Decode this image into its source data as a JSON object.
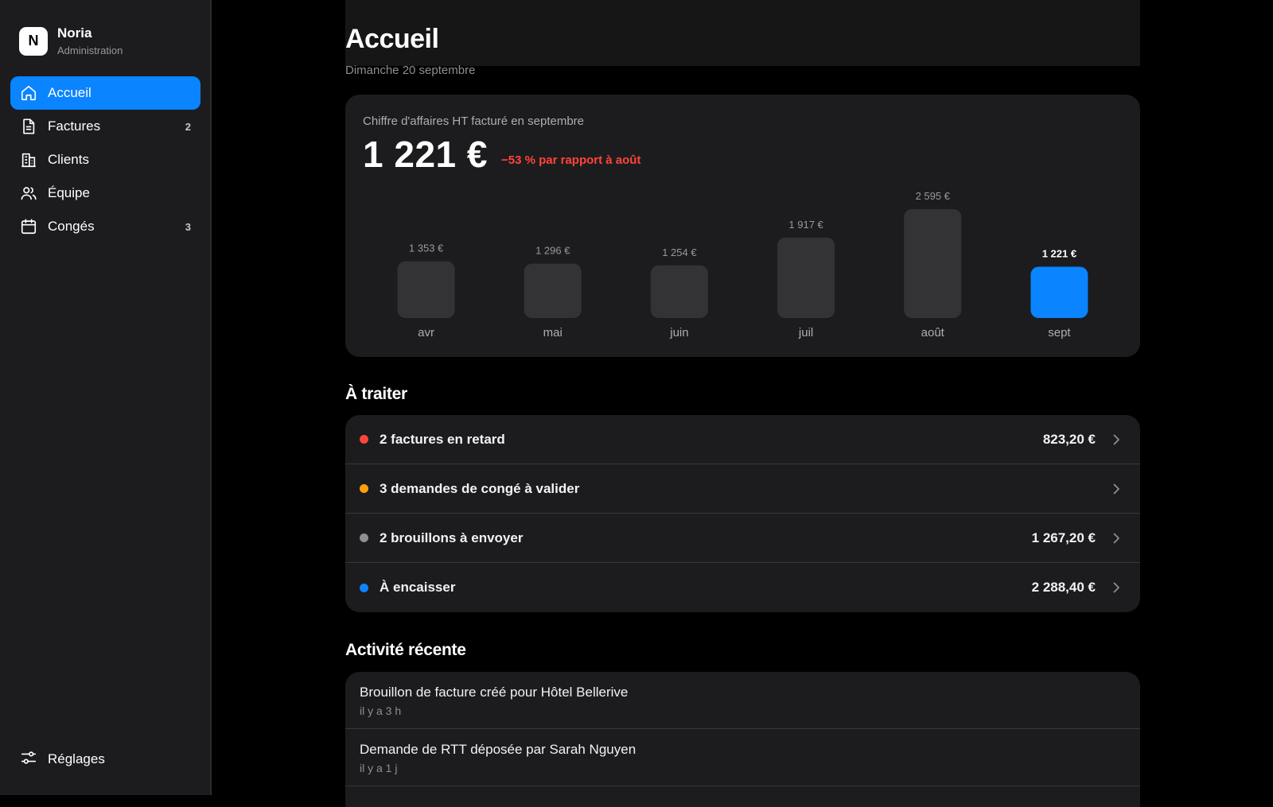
{
  "brand": {
    "initial": "N",
    "name": "Noria",
    "subtitle": "Administration"
  },
  "sidebar": {
    "items": [
      {
        "label": "Accueil",
        "icon": "home-icon",
        "badge": ""
      },
      {
        "label": "Factures",
        "icon": "document-icon",
        "badge": "2"
      },
      {
        "label": "Clients",
        "icon": "building-icon",
        "badge": ""
      },
      {
        "label": "Équipe",
        "icon": "users-icon",
        "badge": ""
      },
      {
        "label": "Congés",
        "icon": "calendar-icon",
        "badge": "3"
      }
    ],
    "settings_label": "Réglages"
  },
  "page": {
    "title": "Accueil",
    "date": "Dimanche 20 septembre"
  },
  "revenue": {
    "label": "Chiffre d'affaires HT facturé en septembre",
    "amount": "1 221 €",
    "delta": "−53 % par rapport à août"
  },
  "chart_data": {
    "type": "bar",
    "categories": [
      "avr",
      "mai",
      "juin",
      "juil",
      "août",
      "sept"
    ],
    "values": [
      1353,
      1296,
      1254,
      1917,
      2595,
      1221
    ],
    "value_labels": [
      "1 353 €",
      "1 296 €",
      "1 254 €",
      "1 917 €",
      "2 595 €",
      "1 221 €"
    ],
    "highlight_index": 5,
    "colors": {
      "bar": "#333335",
      "highlight": "#0a84ff"
    }
  },
  "todo": {
    "title": "À traiter",
    "items": [
      {
        "label": "2 factures en retard",
        "amount": "823,20 €",
        "color": "#ff453a"
      },
      {
        "label": "3 demandes de congé à valider",
        "amount": "",
        "color": "#ff9f0a"
      },
      {
        "label": "2 brouillons à envoyer",
        "amount": "1 267,20 €",
        "color": "#8e8e93"
      },
      {
        "label": "À encaisser",
        "amount": "2 288,40 €",
        "color": "#0a84ff"
      }
    ]
  },
  "activity": {
    "title": "Activité récente",
    "items": [
      {
        "title": "Brouillon de facture créé pour Hôtel Bellerive",
        "time": "il y a 3 h"
      },
      {
        "title": "Demande de RTT déposée par Sarah Nguyen",
        "time": "il y a 1 j"
      }
    ]
  }
}
